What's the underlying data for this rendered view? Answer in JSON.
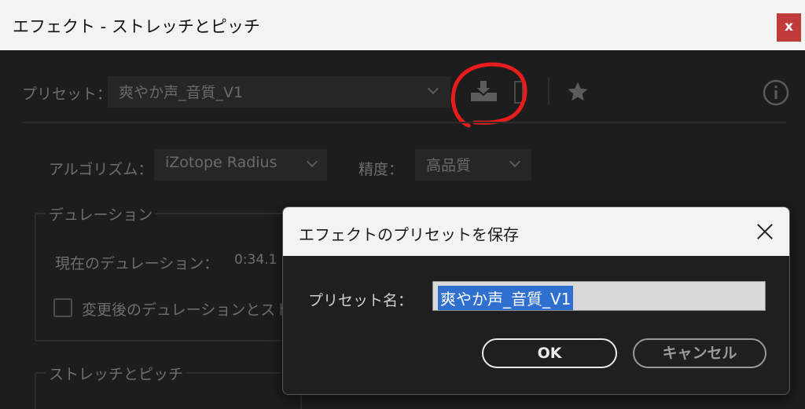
{
  "window": {
    "title": "エフェクト - ストレッチとピッチ",
    "close_label": "x"
  },
  "preset": {
    "label": "プリセット：",
    "value": "爽やか声_音質_V1",
    "icons": [
      "download-icon",
      "trash-icon",
      "star-icon",
      "info-icon"
    ]
  },
  "algorithm": {
    "label": "アルゴリズム：",
    "value": "iZotope Radius"
  },
  "precision": {
    "label": "精度：",
    "value": "高品質"
  },
  "duration": {
    "legend": "デュレーション",
    "current_label": "現在のデュレーション：",
    "current_value": "0:34.1",
    "checkbox_label": "変更後のデュレーションとスト"
  },
  "stretch_pitch": {
    "legend": "ストレッチとピッチ"
  },
  "dialog": {
    "title": "エフェクトのプリセットを保存",
    "name_label": "プリセット名：",
    "name_value": "爽やか声_音質_V1",
    "ok_label": "OK",
    "cancel_label": "キャンセル"
  },
  "colors": {
    "annotation": "#e81c1c",
    "selection": "#2f6fcf",
    "close_button": "#c23b3b"
  }
}
